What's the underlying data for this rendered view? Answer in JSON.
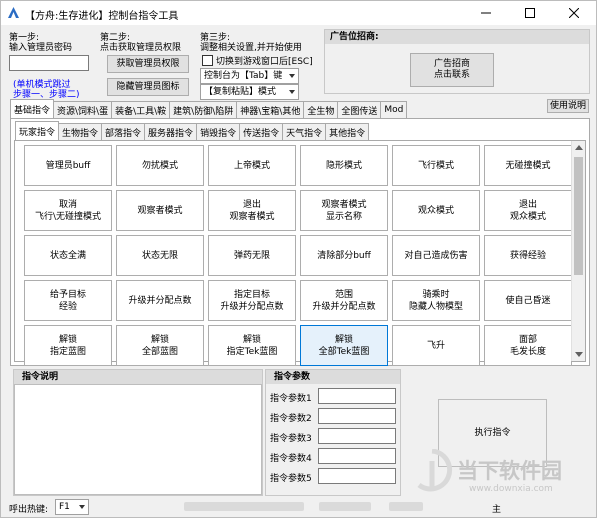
{
  "window": {
    "title": "【方舟:生存进化】控制台指令工具",
    "controls": [
      "minimize",
      "maximize",
      "close"
    ]
  },
  "steps": {
    "step1_title": "第一步:",
    "step1_desc": "输入管理员密码",
    "step1_note_line1": "(单机模式跳过",
    "step1_note_line2": "步骤一、步骤二)",
    "step2_title": "第二步:",
    "step2_desc": "点击获取管理员权限",
    "step2_btn_get": "获取管理员权限",
    "step2_btn_hide": "隐藏管理员图标",
    "step3_title": "第三步:",
    "step3_desc": "调整相关设置,并开始使用",
    "step3_checkbox": "切换到游戏窗口后[ESC]",
    "step3_console_key": "控制台为【Tab】键",
    "step3_paste_mode": "【复制粘贴】模式"
  },
  "ad": {
    "title": "广告位招商:",
    "button": "广告招商\n点击联系"
  },
  "main_tabs": [
    "基础指令",
    "资源\\饲料\\蛋",
    "装备\\工具\\鞍",
    "建筑\\防御\\陷阱",
    "神器\\宝箱\\其他",
    "全生物",
    "全图传送",
    "Mod"
  ],
  "help_button": "使用说明",
  "sub_tabs": [
    "玩家指令",
    "生物指令",
    "部落指令",
    "服务器指令",
    "销毁指令",
    "传送指令",
    "天气指令",
    "其他指令"
  ],
  "commands": [
    [
      "管理员buff",
      "勿扰模式",
      "上帝模式",
      "隐形模式",
      "飞行模式",
      "无碰撞模式"
    ],
    [
      "取消\n飞行\\无碰撞模式",
      "观察者模式",
      "退出\n观察者模式",
      "观察者模式\n显示名称",
      "观众模式",
      "退出\n观众模式"
    ],
    [
      "状态全满",
      "状态无限",
      "弹药无限",
      "清除部分buff",
      "对自己造成伤害",
      "获得经验"
    ],
    [
      "给予目标\n经验",
      "升级并分配点数",
      "指定目标\n升级并分配点数",
      "范围\n升级并分配点数",
      "骑乘时\n隐藏人物模型",
      "使自己昏迷"
    ],
    [
      "解锁\n指定蓝图",
      "解锁\n全部蓝图",
      "解锁\n指定Tek蓝图",
      "解锁\n全部Tek蓝图",
      "飞升",
      "面部\n毛发长度"
    ]
  ],
  "explain": {
    "title": "指令说明"
  },
  "params": {
    "title": "指令参数",
    "labels": [
      "指令参数1",
      "指令参数2",
      "指令参数3",
      "指令参数4",
      "指令参数5"
    ]
  },
  "execute_button": "执行指令",
  "footer": {
    "hotkey_label": "呼出热键:",
    "hotkey_value": "F1",
    "partial_text": "主"
  },
  "watermark": {
    "text": "当下软件园",
    "url": "www.downxia.com"
  },
  "colors": {
    "accent_blue": "#0000ff",
    "highlight_bg": "#e5f1fb",
    "highlight_border": "#0078d7"
  }
}
